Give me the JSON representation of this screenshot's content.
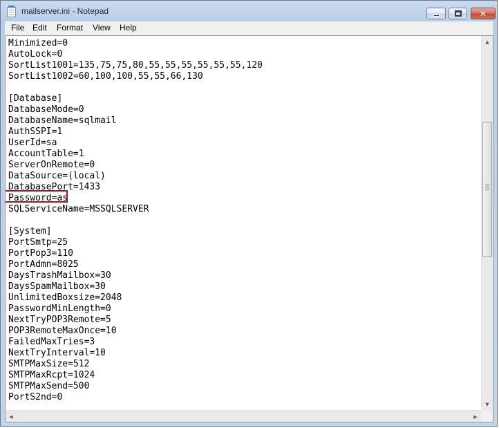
{
  "window": {
    "title": "mailserver.ini - Notepad"
  },
  "menu": {
    "items": [
      "File",
      "Edit",
      "Format",
      "View",
      "Help"
    ]
  },
  "editor": {
    "lines": [
      "Minimized=0",
      "AutoLock=0",
      "SortList1001=135,75,75,80,55,55,55,55,55,55,120",
      "SortList1002=60,100,100,55,55,66,130",
      "",
      "[Database]",
      "DatabaseMode=0",
      "DatabaseName=sqlmail",
      "AuthSSPI=1",
      "UserId=sa",
      "AccountTable=1",
      "ServerOnRemote=0",
      "DataSource=(local)",
      "DatabasePort=1433",
      "Password=as",
      "SQLServiceName=MSSQLSERVER",
      "",
      "[System]",
      "PortSmtp=25",
      "PortPop3=110",
      "PortAdmn=8025",
      "DaysTrashMailbox=30",
      "DaysSpamMailbox=30",
      "UnlimitedBoxsize=2048",
      "PasswordMinLength=0",
      "NextTryPOP3Remote=5",
      "POP3RemoteMaxOnce=10",
      "FailedMaxTries=3",
      "NextTryInterval=10",
      "SMTPMaxSize=512",
      "SMTPMaxRcpt=1024",
      "SMTPMaxSend=500",
      "PortS2nd=0"
    ],
    "highlight_color": "#9b1b22"
  },
  "icons": {
    "app": "notepad-icon",
    "minimize": "minimize-icon",
    "maximize": "maximize-icon",
    "close": "close-icon",
    "scroll_up": "arrow-up-icon",
    "scroll_down": "arrow-down-icon",
    "scroll_left": "arrow-left-icon",
    "scroll_right": "arrow-right-icon"
  },
  "colors": {
    "title_bar": "#b9cde6",
    "close_button": "#c24a34"
  }
}
